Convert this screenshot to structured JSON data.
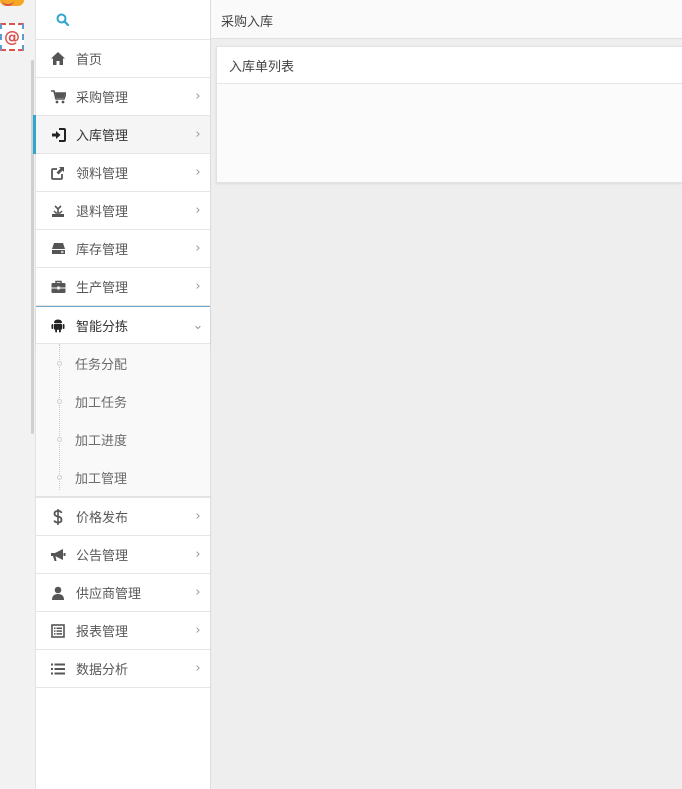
{
  "strip": {
    "mail_icon": "mail-icon",
    "app_icon": "app-icon"
  },
  "search": {
    "icon": "search-icon"
  },
  "sidebar": {
    "items": [
      {
        "label": "首页",
        "icon": "home-icon",
        "chevron": ""
      },
      {
        "label": "采购管理",
        "icon": "cart-icon",
        "chevron": "›"
      },
      {
        "label": "入库管理",
        "icon": "sign-in-icon",
        "chevron": "›"
      },
      {
        "label": "领料管理",
        "icon": "share-icon",
        "chevron": "›"
      },
      {
        "label": "退料管理",
        "icon": "return-icon",
        "chevron": "›"
      },
      {
        "label": "库存管理",
        "icon": "drive-icon",
        "chevron": "›"
      },
      {
        "label": "生产管理",
        "icon": "briefcase-icon",
        "chevron": "›"
      },
      {
        "label": "智能分拣",
        "icon": "android-icon",
        "chevron": "⌄"
      },
      {
        "label": "价格发布",
        "icon": "dollar-icon",
        "chevron": "›"
      },
      {
        "label": "公告管理",
        "icon": "bullhorn-icon",
        "chevron": "›"
      },
      {
        "label": "供应商管理",
        "icon": "user-icon",
        "chevron": "›"
      },
      {
        "label": "报表管理",
        "icon": "list-alt-icon",
        "chevron": "›"
      },
      {
        "label": "数据分析",
        "icon": "list-icon",
        "chevron": "›"
      }
    ],
    "submenu": [
      {
        "label": "任务分配"
      },
      {
        "label": "加工任务"
      },
      {
        "label": "加工进度"
      },
      {
        "label": "加工管理"
      }
    ]
  },
  "topbar": {
    "breadcrumb": "采购入库"
  },
  "panel": {
    "title": "入库单列表"
  },
  "colors": {
    "accent": "#2fa6d0",
    "icon": "#555555"
  }
}
